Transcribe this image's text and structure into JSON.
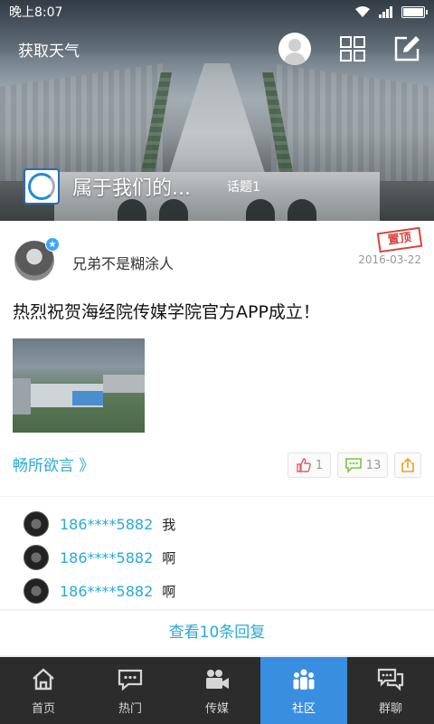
{
  "status_bar": {
    "time": "晚上8:07",
    "battery_level": 0.9
  },
  "header": {
    "weather_label": "获取天气",
    "community_name": "属于我们的...",
    "topic_count": "话题1",
    "icons": [
      "user-avatar-icon",
      "grid-icon",
      "compose-icon"
    ]
  },
  "post": {
    "author": "兄弟不是糊涂人",
    "pinned_stamp": "置顶",
    "date": "2016-03-22",
    "title": "热烈祝贺海经院传媒学院官方APP成立！",
    "board_link": "畅所欲言 》",
    "likes": "1",
    "comments": "13",
    "colors": {
      "accent": "#29a9d6",
      "stamp": "#d9433c"
    }
  },
  "comments": [
    {
      "user": "186****5882",
      "text": "我"
    },
    {
      "user": "186****5882",
      "text": "啊"
    },
    {
      "user": "186****5882",
      "text": "啊"
    }
  ],
  "more_replies": "查看10条回复",
  "nav": {
    "items": [
      {
        "label": "首页",
        "icon": "home-icon"
      },
      {
        "label": "热门",
        "icon": "chat-icon"
      },
      {
        "label": "传媒",
        "icon": "video-camera-icon"
      },
      {
        "label": "社区",
        "icon": "people-icon",
        "active": true
      },
      {
        "label": "群聊",
        "icon": "group-chat-icon"
      }
    ],
    "active_color": "#3a8ee0"
  }
}
